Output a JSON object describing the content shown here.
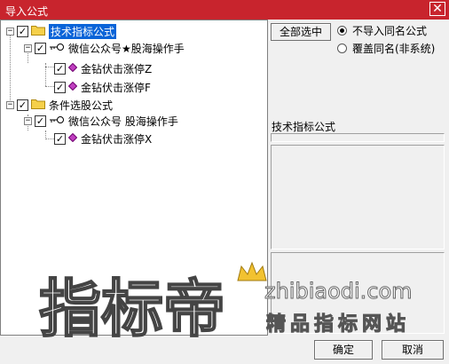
{
  "window": {
    "title": "导入公式",
    "close_glyph": "✕"
  },
  "tree": {
    "groups": [
      {
        "label": "技术指标公式",
        "expander": "−",
        "checked": "✓",
        "selected": true,
        "children": [
          {
            "label": "微信公众号★股海操作手",
            "expander": "−",
            "checked": "✓",
            "children": [
              {
                "label": "金钻伏击涨停Z",
                "checked": "✓"
              },
              {
                "label": "金钻伏击涨停F",
                "checked": "✓"
              }
            ]
          }
        ]
      },
      {
        "label": "条件选股公式",
        "expander": "−",
        "checked": "✓",
        "selected": false,
        "children": [
          {
            "label": "微信公众号 股海操作手",
            "expander": "−",
            "checked": "✓",
            "children": [
              {
                "label": "金钻伏击涨停X",
                "checked": "✓"
              }
            ]
          }
        ]
      }
    ]
  },
  "right": {
    "select_all_label": "全部选中",
    "radio_options": [
      {
        "label": "不导入同名公式",
        "selected": true
      },
      {
        "label": "覆盖同名(非系统)",
        "selected": false
      }
    ],
    "formula_type_label": "技术指标公式"
  },
  "footer": {
    "ok_label": "确定",
    "cancel_label": "取消"
  },
  "watermark": {
    "logo_text": "指标帝",
    "domain": "zhibiaodi.com",
    "slogan": "精品指标网站"
  },
  "colors": {
    "titlebar": "#c8242d",
    "selection": "#0a64d8",
    "folder": "#f5d04a"
  }
}
